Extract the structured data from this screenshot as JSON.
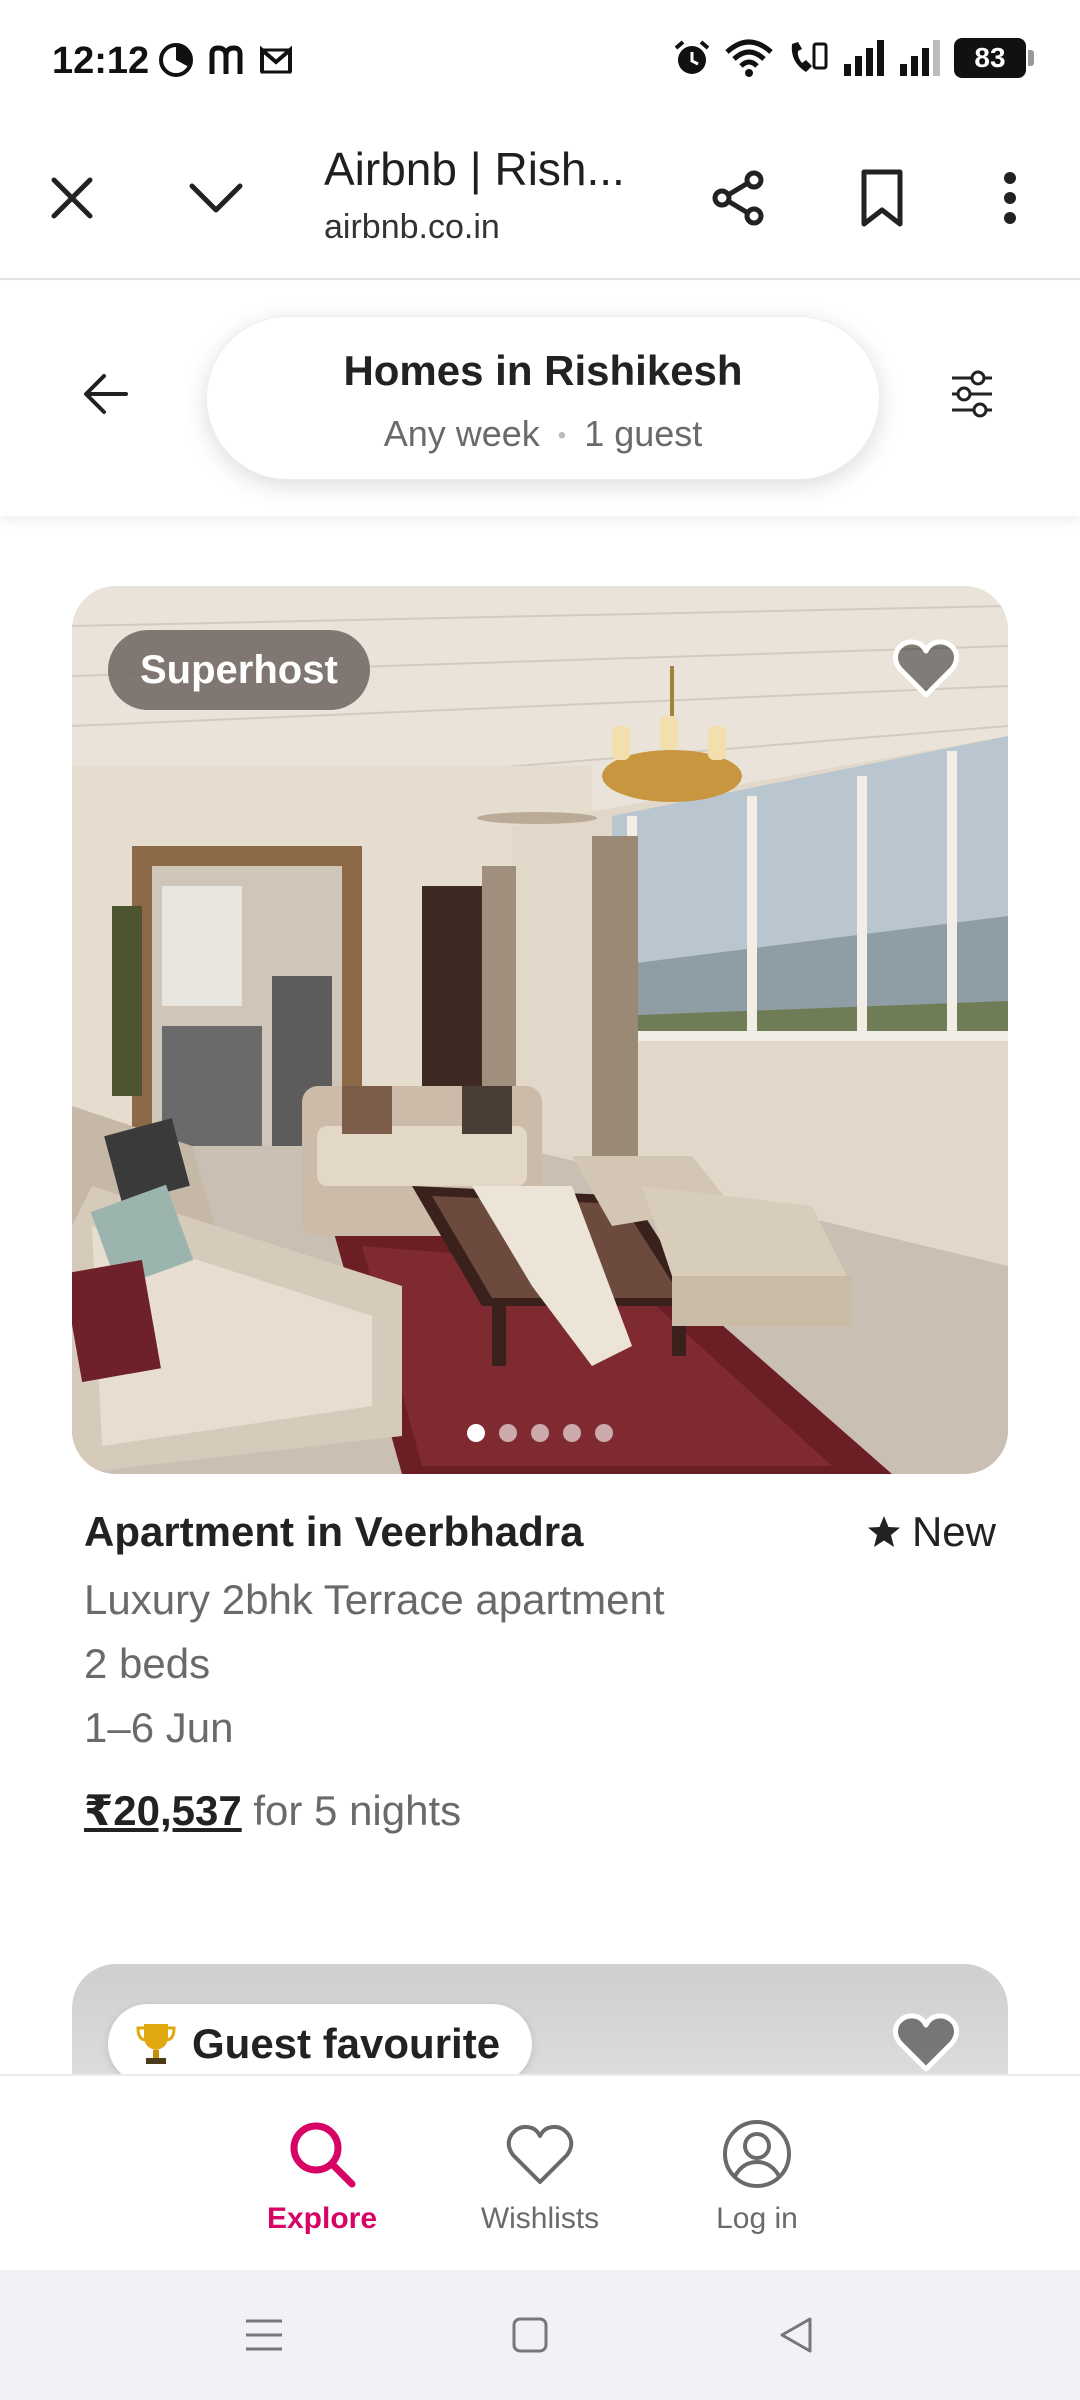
{
  "status_bar": {
    "time": "12:12",
    "battery": "83"
  },
  "browser": {
    "title": "Airbnb | Rish...",
    "url": "airbnb.co.in"
  },
  "search": {
    "title": "Homes in Rishikesh",
    "dates": "Any week",
    "guests": "1 guest"
  },
  "listing": {
    "badge": "Superhost",
    "title": "Apartment in Veerbhadra",
    "rating": "New",
    "description": "Luxury 2bhk Terrace apartment",
    "beds": "2 beds",
    "dates": "1–6 Jun",
    "price": "₹20,537",
    "price_suffix": "for 5 nights",
    "photo_count": 5,
    "active_photo": 1
  },
  "next_listing": {
    "badge": "Guest favourite"
  },
  "bottom_nav": {
    "explore": "Explore",
    "wishlists": "Wishlists",
    "login": "Log in"
  },
  "colors": {
    "brand": "#d70466",
    "text": "#222222",
    "muted": "#6a6a6a"
  }
}
